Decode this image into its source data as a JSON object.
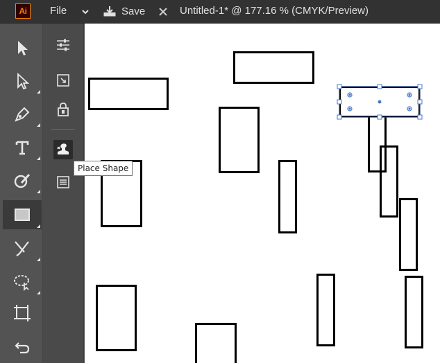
{
  "app": {
    "logo_text": "Ai",
    "accent": "#ff7c00"
  },
  "topbar": {
    "file_label": "File",
    "save_label": "Save",
    "document_title": "Untitled-1* @ 177.16 % (CMYK/Preview)"
  },
  "toolbar": {
    "tools": [
      {
        "name": "selection-tool",
        "icon": "arrow-icon",
        "active": false
      },
      {
        "name": "direct-selection-tool",
        "icon": "hollow-arrow-icon",
        "active": false
      },
      {
        "name": "pen-tool",
        "icon": "pen-icon",
        "active": false
      },
      {
        "name": "type-tool",
        "icon": "type-icon",
        "active": false
      },
      {
        "name": "shaper-tool",
        "icon": "shaper-icon",
        "active": false
      },
      {
        "name": "rectangle-tool",
        "icon": "rectangle-icon",
        "active": true
      },
      {
        "name": "paintbrush-tool",
        "icon": "brush-icon",
        "active": false
      },
      {
        "name": "lasso-tool",
        "icon": "lasso-icon",
        "active": false
      },
      {
        "name": "artboard-tool",
        "icon": "artboard-icon",
        "active": false
      },
      {
        "name": "undo",
        "icon": "undo-icon",
        "active": false
      }
    ]
  },
  "panel": {
    "buttons": [
      {
        "name": "properties-button",
        "icon": "sliders-icon"
      },
      {
        "name": "transform-button",
        "icon": "transform-icon"
      },
      {
        "name": "lock-button",
        "icon": "lock-icon"
      },
      {
        "name": "place-shape-button",
        "icon": "place-shape-icon",
        "active": true
      },
      {
        "name": "document-button",
        "icon": "document-icon"
      }
    ],
    "tooltip": "Place Shape"
  },
  "canvas": {
    "background": "#ffffff",
    "selection_color": "#1a3d8c",
    "handle_color": "#4a78c8"
  }
}
